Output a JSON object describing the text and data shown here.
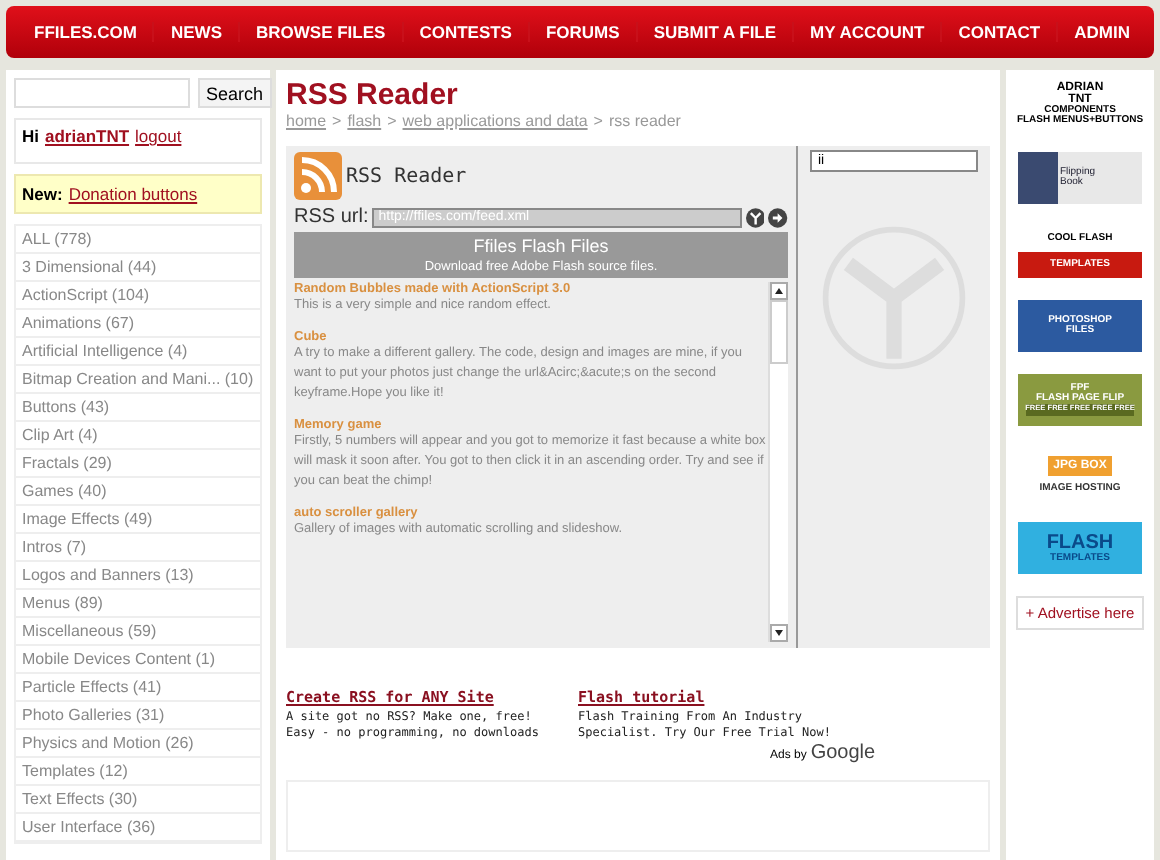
{
  "nav": [
    {
      "label": "FFILES.COM"
    },
    {
      "label": "NEWS"
    },
    {
      "label": "BROWSE FILES"
    },
    {
      "label": "CONTESTS"
    },
    {
      "label": "FORUMS"
    },
    {
      "label": "SUBMIT A FILE"
    },
    {
      "label": "MY ACCOUNT"
    },
    {
      "label": "CONTACT"
    },
    {
      "label": "ADMIN"
    }
  ],
  "sidebar": {
    "search_button": "Search",
    "greeting": "Hi",
    "username": "adrianTNT",
    "logout": "logout",
    "news_label": "New:",
    "news_link": "Donation buttons",
    "categories": [
      "ALL (778)",
      "3 Dimensional (44)",
      "ActionScript (104)",
      "Animations (67)",
      "Artificial Intelligence (4)",
      "Bitmap Creation and Mani... (10)",
      "Buttons (43)",
      "Clip Art (4)",
      "Fractals (29)",
      "Games (40)",
      "Image Effects (49)",
      "Intros (7)",
      "Logos and Banners (13)",
      "Menus (89)",
      "Miscellaneous (59)",
      "Mobile Devices Content (1)",
      "Particle Effects (41)",
      "Photo Galleries (31)",
      "Physics and Motion (26)",
      "Templates (12)",
      "Text Effects (30)",
      "User Interface (36)"
    ]
  },
  "main": {
    "title": "RSS Reader",
    "breadcrumb_separator": ">",
    "breadcrumb": [
      {
        "label": "home",
        "link": true
      },
      {
        "label": "flash",
        "link": true
      },
      {
        "label": "web applications and data",
        "link": true
      },
      {
        "label": "rss reader",
        "link": false
      }
    ],
    "reader": {
      "title": "RSS Reader",
      "url_label": "RSS url:",
      "url_value": "http://ffiles.com/feed.xml",
      "feed_title": "Ffiles Flash Files",
      "feed_subtitle": "Download free Adobe Flash source files.",
      "side_field": "ii",
      "items": [
        {
          "title": "Random Bubbles made with ActionScript 3.0",
          "text": "This is a very simple and nice random effect."
        },
        {
          "title": "Cube",
          "text": "A try to make a different gallery. The code, design and images are mine, if you want to put your photos just change the url&Acirc;&acute;s on the second keyframe.Hope you like it!"
        },
        {
          "title": "Memory game",
          "text": "Firstly, 5 numbers will appear and you got to memorize it fast because a white box will mask it soon after. You got to then click it in an ascending order. Try and see if you can beat the chimp!"
        },
        {
          "title": "auto scroller gallery",
          "text": "Gallery of images with automatic scrolling and slideshow."
        }
      ]
    },
    "ads": [
      {
        "title": "Create RSS for ANY Site",
        "text": "A site got no RSS? Make one, free! Easy - no programming, no downloads"
      },
      {
        "title": "Flash tutorial",
        "text": "Flash Training From An Industry Specialist. Try Our Free Trial Now!"
      }
    ],
    "ads_by": "Ads by",
    "ads_brand": "Google"
  },
  "banners": [
    {
      "kind": "adrian",
      "texts": [
        "ADRIAN",
        "TNT",
        "COMPONENTS",
        "FLASH MENUS+BUTTONS"
      ]
    },
    {
      "kind": "book",
      "texts": [
        "Flipping",
        "Book"
      ]
    },
    {
      "kind": "cool",
      "texts": [
        "COOL FLASH",
        "TEMPLATES"
      ]
    },
    {
      "kind": "photoshop",
      "texts": [
        "PHOTOSHOP",
        "FILES"
      ]
    },
    {
      "kind": "pageflip",
      "texts": [
        "FPF",
        "FLASH PAGE FLIP",
        "FREE FREE FREE FREE FREE"
      ]
    },
    {
      "kind": "jpgbox",
      "texts": [
        "JPG BOX",
        "IMAGE HOSTING"
      ]
    },
    {
      "kind": "flash",
      "texts": [
        "FLASH",
        "TEMPLATES"
      ]
    }
  ],
  "advertise": "+ Advertise here"
}
